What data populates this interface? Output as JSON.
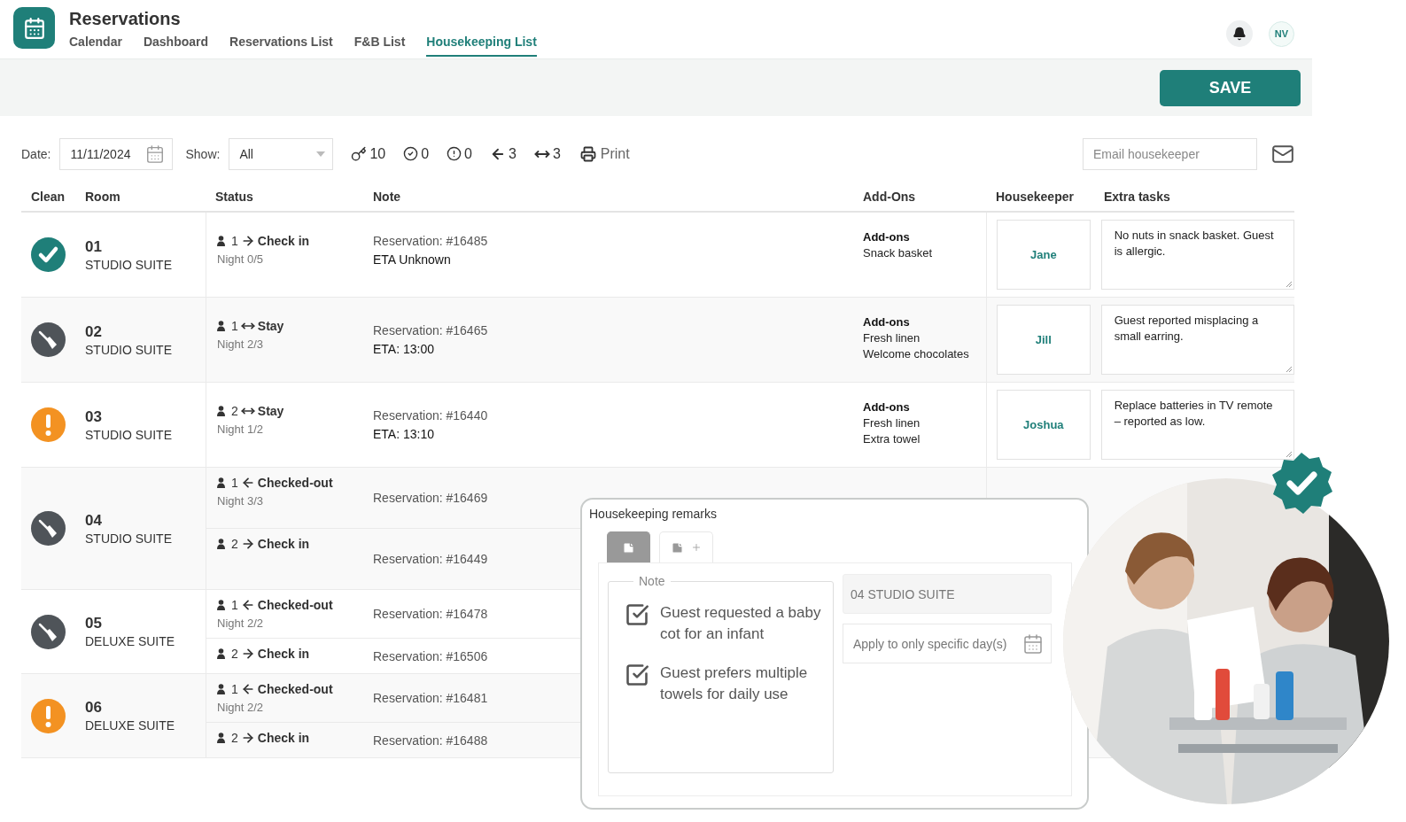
{
  "app": {
    "title": "Reservations",
    "avatar": "NV"
  },
  "tabs": [
    {
      "label": "Calendar",
      "selected": false
    },
    {
      "label": "Dashboard",
      "selected": false
    },
    {
      "label": "Reservations List",
      "selected": false
    },
    {
      "label": "F&B List",
      "selected": false
    },
    {
      "label": "Housekeeping List",
      "selected": true
    }
  ],
  "save_button": "SAVE",
  "toolbar": {
    "date_label": "Date:",
    "date": "11/11/2024",
    "show_label": "Show:",
    "show": "All",
    "counters": [
      {
        "kind": "keys",
        "value": "10"
      },
      {
        "kind": "clean",
        "value": "0"
      },
      {
        "kind": "alert",
        "value": "0"
      },
      {
        "kind": "checkout",
        "value": "3"
      },
      {
        "kind": "stay",
        "value": "3"
      }
    ],
    "print": "Print",
    "email_placeholder": "Email housekeeper"
  },
  "table": {
    "columns": [
      "Clean",
      "Room",
      "Status",
      "Note",
      "Add-Ons",
      "Housekeeper",
      "Extra tasks"
    ],
    "rows": [
      {
        "kind": "done",
        "number": "01",
        "type": "STUDIO SUITE",
        "stays": [
          {
            "guests": "1",
            "kind": "checkin",
            "label": "Check in",
            "night": "Night 0/5",
            "reservation": "Reservation: #16485",
            "eta": "ETA Unknown"
          }
        ],
        "addons": {
          "title": "Add-ons",
          "items": [
            "Snack basket"
          ]
        },
        "housekeeper": "Jane",
        "extra_tasks": "No nuts in snack basket. Guest is allergic."
      },
      {
        "kind": "dirty",
        "number": "02",
        "type": "STUDIO SUITE",
        "stays": [
          {
            "guests": "1",
            "kind": "stay",
            "label": "Stay",
            "night": "Night 2/3",
            "reservation": "Reservation: #16465",
            "eta": "ETA: 13:00"
          }
        ],
        "addons": {
          "title": "Add-ons",
          "items": [
            "Fresh linen",
            "Welcome chocolates"
          ]
        },
        "housekeeper": "Jill",
        "extra_tasks": "Guest reported misplacing a small earring."
      },
      {
        "kind": "attention",
        "number": "03",
        "type": "STUDIO SUITE",
        "stays": [
          {
            "guests": "2",
            "kind": "stay",
            "label": "Stay",
            "night": "Night 1/2",
            "reservation": "Reservation: #16440",
            "eta": "ETA: 13:10"
          }
        ],
        "addons": {
          "title": "Add-ons",
          "items": [
            "Fresh linen",
            "Extra towel"
          ]
        },
        "housekeeper": "Joshua",
        "extra_tasks": "Replace batteries in TV remote – reported as low."
      },
      {
        "kind": "dirty",
        "number": "04",
        "type": "STUDIO SUITE",
        "stays": [
          {
            "guests": "1",
            "kind": "checkout",
            "label": "Checked-out",
            "night": "Night 3/3",
            "reservation": "Reservation: #16469"
          },
          {
            "guests": "2",
            "kind": "checkin",
            "label": "Check in",
            "reservation": "Reservation: #16449"
          }
        ]
      },
      {
        "kind": "dirty",
        "number": "05",
        "type": "DELUXE SUITE",
        "stays": [
          {
            "guests": "1",
            "kind": "checkout",
            "label": "Checked-out",
            "night": "Night 2/2",
            "reservation": "Reservation: #16478"
          },
          {
            "guests": "2",
            "kind": "checkin",
            "label": "Check in",
            "reservation": "Reservation: #16506"
          }
        ]
      },
      {
        "kind": "attention",
        "number": "06",
        "type": "DELUXE SUITE",
        "stays": [
          {
            "guests": "1",
            "kind": "checkout",
            "label": "Checked-out",
            "night": "Night 2/2",
            "reservation": "Reservation: #16481"
          },
          {
            "guests": "2",
            "kind": "checkin",
            "label": "Check in",
            "reservation": "Reservation: #16488"
          }
        ]
      }
    ]
  },
  "remarks": {
    "title": "Housekeeping remarks",
    "tabs": [
      {
        "kind": "note",
        "selected": true
      },
      {
        "kind": "add",
        "selected": false
      }
    ],
    "note_legend": "Note",
    "items": [
      {
        "text": "Guest requested a baby cot for an infant",
        "checked": true
      },
      {
        "text": "Guest prefers multiple towels for daily use",
        "checked": true
      }
    ],
    "room": "04 STUDIO SUITE",
    "days_placeholder": "Apply to only specific day(s)"
  }
}
